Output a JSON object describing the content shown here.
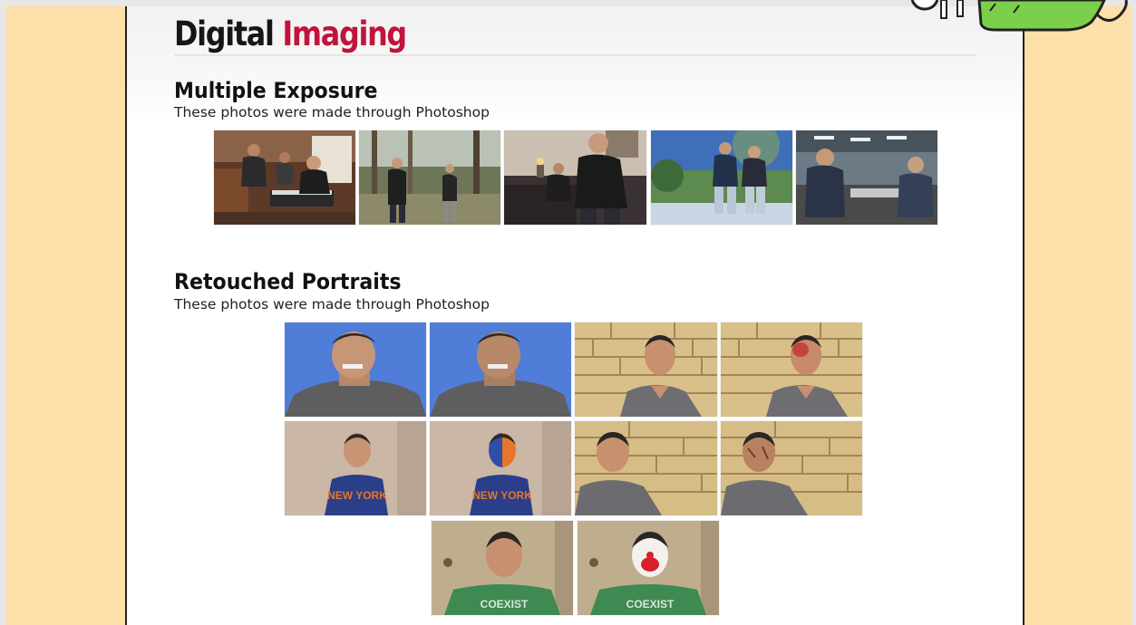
{
  "page": {
    "title_part1": "Digital",
    "title_part2": "Imaging"
  },
  "sections": [
    {
      "title": "Multiple Exposure",
      "subtitle": "These photos were made through Photoshop"
    },
    {
      "title": "Retouched Portraits",
      "subtitle": "These photos were made through Photoshop"
    }
  ],
  "colors": {
    "page_background": "#fde0a9",
    "heading_accent": "#c0143c",
    "heading_dark": "#161616"
  }
}
